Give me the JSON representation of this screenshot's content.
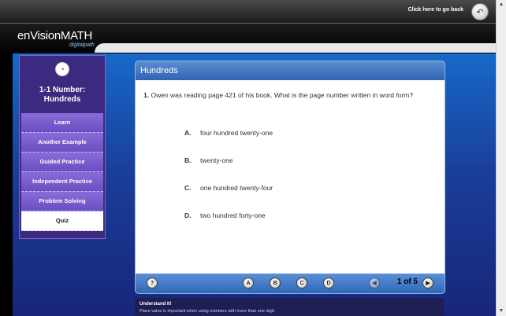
{
  "topbar": {
    "back_text": "Click here to go back"
  },
  "brand": {
    "logo_main": "enVisionMATH",
    "logo_sub": "digitalpath"
  },
  "sidebar": {
    "title": "1-1 Number: Hundreds",
    "items": [
      {
        "label": "Learn"
      },
      {
        "label": "Another Example"
      },
      {
        "label": "Guided Practice"
      },
      {
        "label": "Independent Practice"
      },
      {
        "label": "Problem Solving"
      },
      {
        "label": "Quiz"
      }
    ]
  },
  "card": {
    "title": "Hundreds",
    "question_number": "1.",
    "question_text": "Owen was reading page 421 of his book. What is the page number written in word form?",
    "answers": [
      {
        "letter": "A.",
        "text": "four hundred twenty-one"
      },
      {
        "letter": "B.",
        "text": "twenty-one"
      },
      {
        "letter": "C.",
        "text": "one hundred twenty-four"
      },
      {
        "letter": "D.",
        "text": "two hundred forty-one"
      }
    ]
  },
  "footer": {
    "help": "?",
    "choices": [
      "A",
      "B",
      "C",
      "D"
    ],
    "page": "1 of 5"
  },
  "understand": {
    "title": "Understand It!",
    "text": "Place value is important when using numbers with more than one digit."
  }
}
